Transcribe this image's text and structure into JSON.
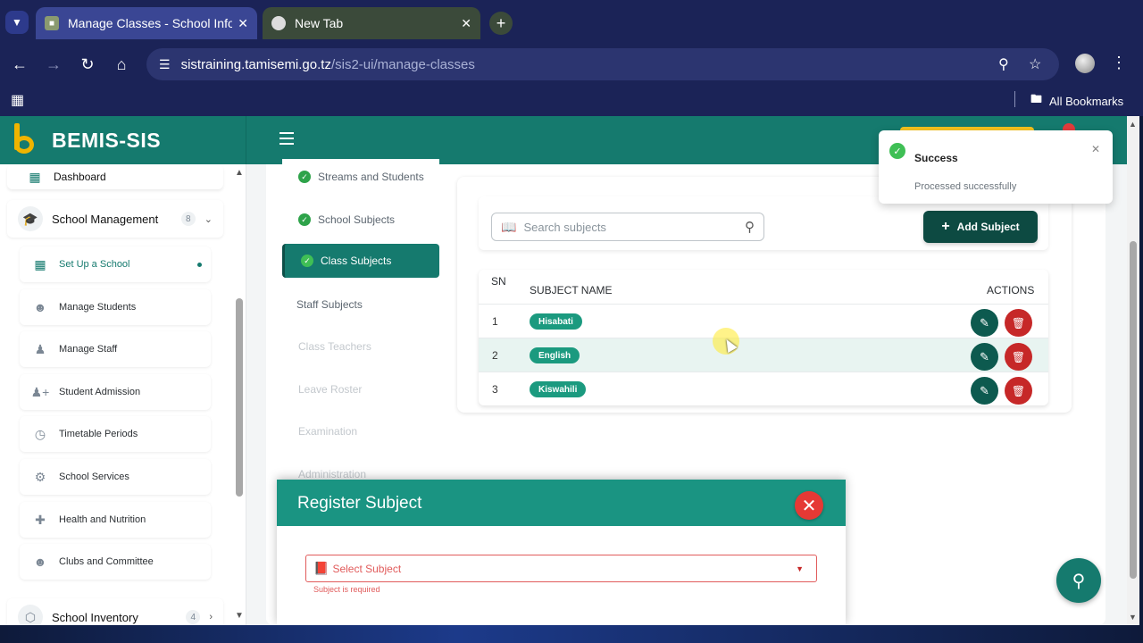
{
  "browser": {
    "tabs": [
      {
        "title": "Manage Classes - School Inform",
        "active": true
      },
      {
        "title": "New Tab",
        "active": false
      }
    ],
    "url_host": "sistraining.tamisemi.go.tz",
    "url_path": "/sis2-ui/manage-classes",
    "bookmarks_label": "All Bookmarks"
  },
  "app": {
    "brand": "BEMIS-SIS",
    "accent": "#157a6e",
    "notification_count": "3"
  },
  "sidebar": {
    "top_item": {
      "label": "Dashboard",
      "icon": "dashboard-icon"
    },
    "groups": [
      {
        "label": "School Management",
        "count": "8",
        "icon": "school-icon"
      },
      {
        "label": "School Inventory",
        "count": "4",
        "icon": "inventory-icon"
      }
    ],
    "sub_items": [
      {
        "label": "Set Up a School",
        "icon": "building-icon",
        "active": true
      },
      {
        "label": "Manage Students",
        "icon": "students-icon"
      },
      {
        "label": "Manage Staff",
        "icon": "staff-icon"
      },
      {
        "label": "Student Admission",
        "icon": "person-add-icon"
      },
      {
        "label": "Timetable Periods",
        "icon": "calendar-icon"
      },
      {
        "label": "School Services",
        "icon": "services-icon"
      },
      {
        "label": "Health and Nutrition",
        "icon": "health-icon"
      },
      {
        "label": "Clubs and Committee",
        "icon": "group-icon"
      }
    ]
  },
  "steps": [
    {
      "label": "Streams and Students",
      "state": "done"
    },
    {
      "label": "School Subjects",
      "state": "done"
    },
    {
      "label": "Class Subjects",
      "state": "active"
    },
    {
      "label": "Staff Subjects",
      "state": "plain"
    },
    {
      "label": "Class Teachers",
      "state": "faded"
    },
    {
      "label": "Leave Roster",
      "state": "faded"
    },
    {
      "label": "Examination",
      "state": "faded"
    },
    {
      "label": "Administration",
      "state": "faded"
    }
  ],
  "subjects": {
    "search_placeholder": "Search subjects",
    "add_label": "Add Subject",
    "columns": {
      "sn": "SN",
      "name": "SUBJECT NAME",
      "actions": "ACTIONS"
    },
    "rows": [
      {
        "sn": "1",
        "name": "Hisabati"
      },
      {
        "sn": "2",
        "name": "English"
      },
      {
        "sn": "3",
        "name": "Kiswahili"
      }
    ]
  },
  "modal": {
    "title": "Register Subject",
    "select_placeholder": "Select Subject",
    "error": "Subject is required"
  },
  "toast": {
    "title": "Success",
    "message": "Processed successfully"
  }
}
